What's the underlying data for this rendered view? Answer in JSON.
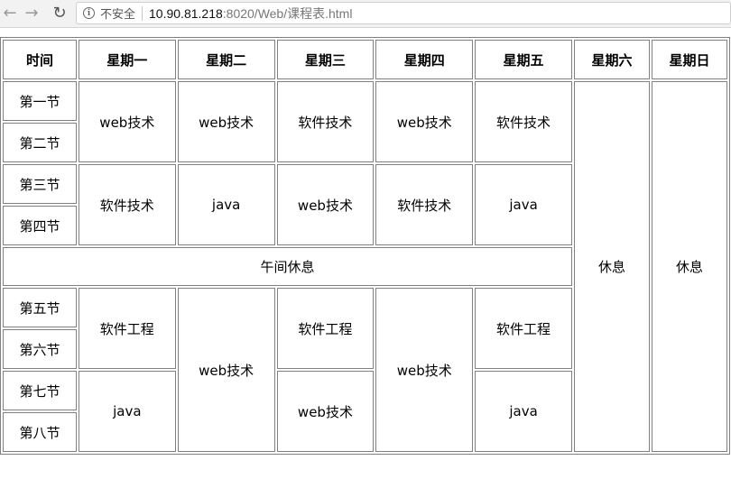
{
  "browser": {
    "security_label": "不安全",
    "url_host": "10.90.81.218",
    "url_rest": ":8020/Web/课程表.html"
  },
  "timetable": {
    "headers": [
      "时间",
      "星期一",
      "星期二",
      "星期三",
      "星期四",
      "星期五",
      "星期六",
      "星期日"
    ],
    "periods": [
      "第一节",
      "第二节",
      "第三节",
      "第四节",
      "第五节",
      "第六节",
      "第七节",
      "第八节"
    ],
    "morning": {
      "block1": [
        "web技术",
        "web技术",
        "软件技术",
        "web技术",
        "软件技术"
      ],
      "block2": [
        "软件技术",
        "java",
        "web技术",
        "软件技术",
        "java"
      ]
    },
    "lunch": "午间休息",
    "rest": [
      "休息",
      "休息"
    ],
    "afternoon": {
      "mon_top": "软件工程",
      "mon_bottom": "java",
      "tue": "web技术",
      "wed_top": "软件工程",
      "wed_bottom": "web技术",
      "thu": "web技术",
      "fri_top": "软件工程",
      "fri_bottom": "java"
    }
  }
}
